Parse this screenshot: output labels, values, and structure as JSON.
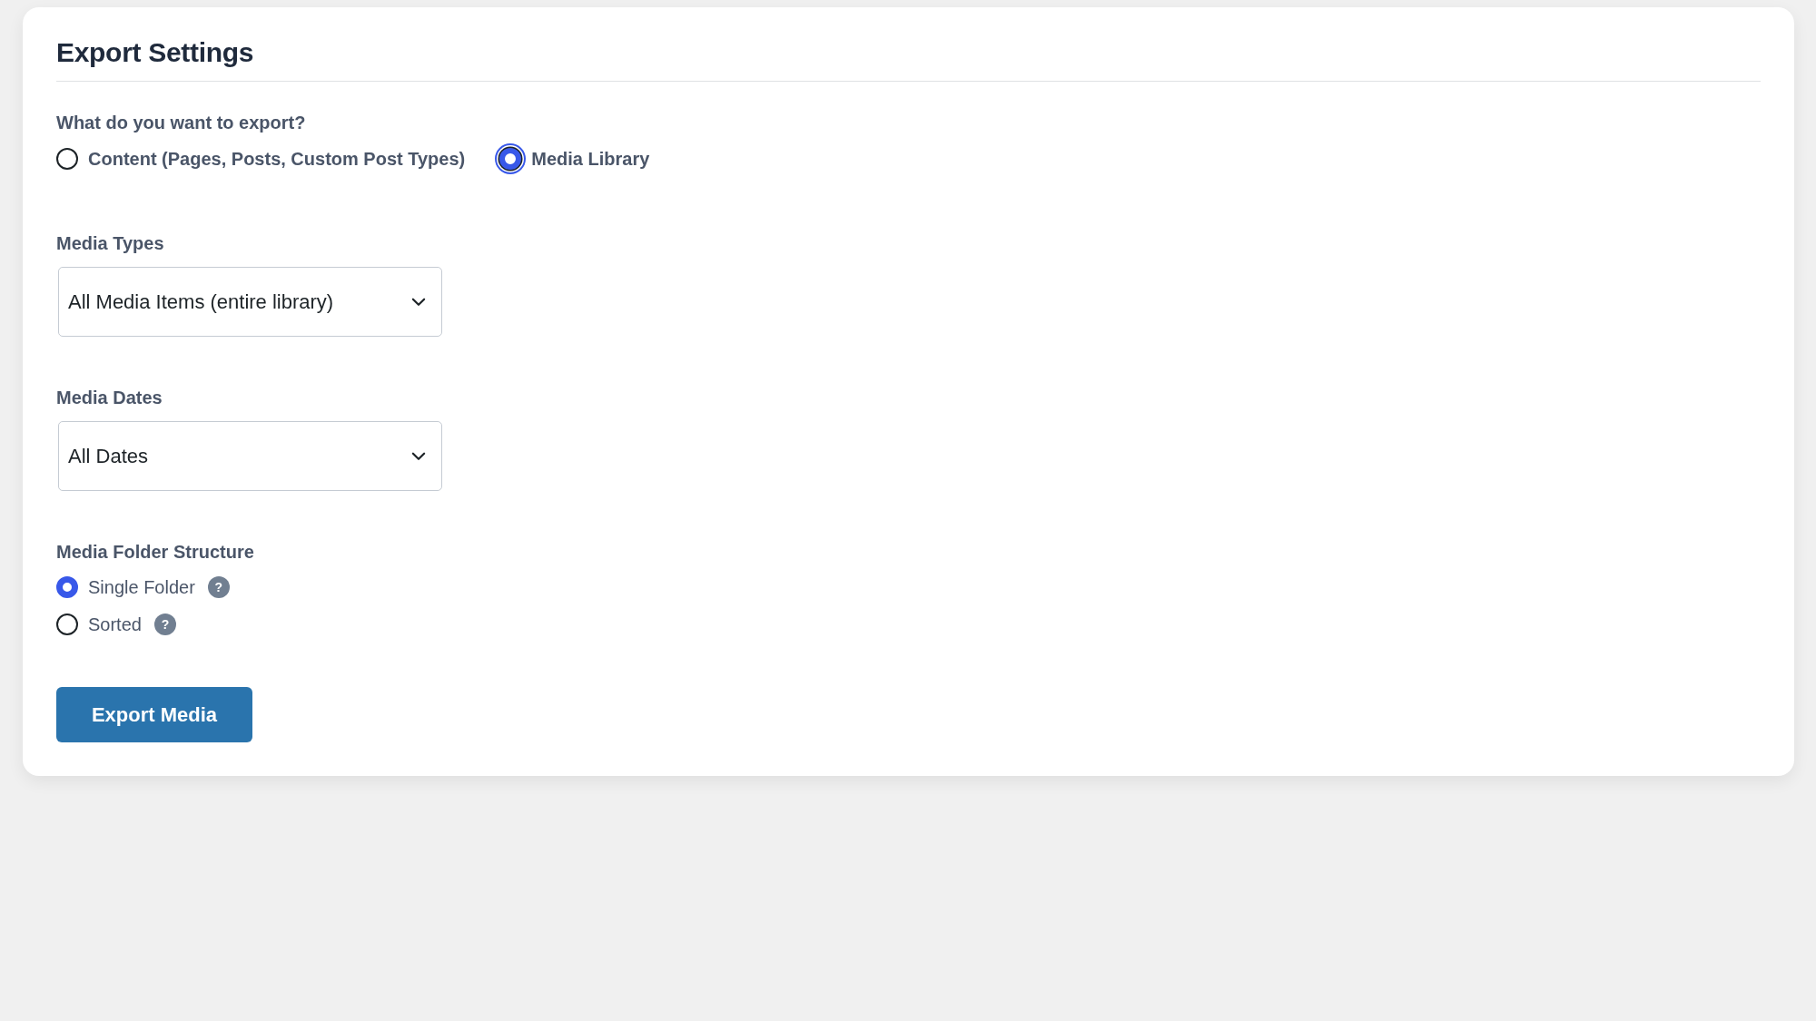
{
  "heading": "Export Settings",
  "export_type": {
    "label": "What do you want to export?",
    "options": [
      {
        "label": "Content (Pages, Posts, Custom Post Types)",
        "selected": false,
        "focused": false
      },
      {
        "label": "Media Library",
        "selected": true,
        "focused": true
      }
    ]
  },
  "media_types": {
    "label": "Media Types",
    "value": "All Media Items (entire library)"
  },
  "media_dates": {
    "label": "Media Dates",
    "value": "All Dates"
  },
  "folder_structure": {
    "label": "Media Folder Structure",
    "options": [
      {
        "label": "Single Folder",
        "selected": true,
        "help": "?"
      },
      {
        "label": "Sorted",
        "selected": false,
        "help": "?"
      }
    ]
  },
  "submit_button": "Export Media"
}
